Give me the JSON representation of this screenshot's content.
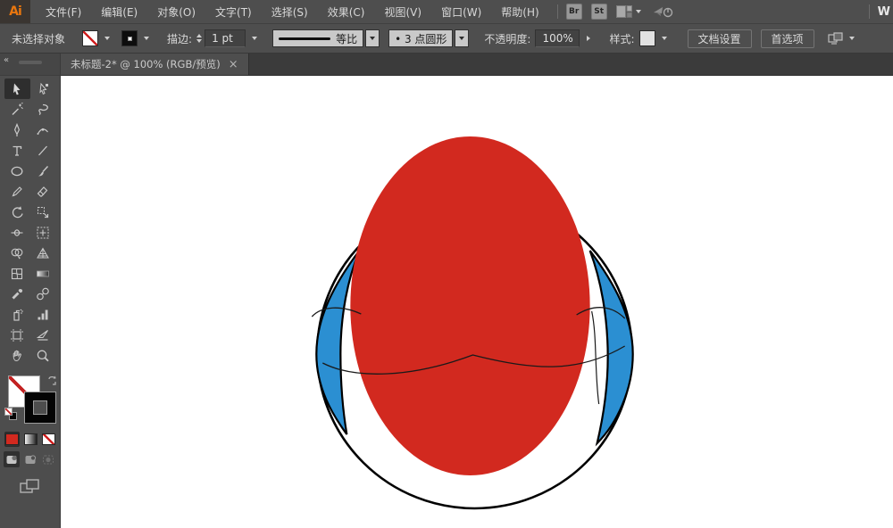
{
  "menu_bar": {
    "logo": "Ai",
    "items": [
      {
        "name": "file",
        "label": "文件(F)"
      },
      {
        "name": "edit",
        "label": "编辑(E)"
      },
      {
        "name": "object",
        "label": "对象(O)"
      },
      {
        "name": "type",
        "label": "文字(T)"
      },
      {
        "name": "select",
        "label": "选择(S)"
      },
      {
        "name": "effect",
        "label": "效果(C)"
      },
      {
        "name": "view",
        "label": "视图(V)"
      },
      {
        "name": "window",
        "label": "窗口(W)"
      },
      {
        "name": "help",
        "label": "帮助(H)"
      }
    ],
    "bridge_label": "Br",
    "stock_label": "St",
    "partial_text": "W"
  },
  "control_bar": {
    "selection_status": "未选择对象",
    "stroke_label": "描边:",
    "stroke_width_value": "1 pt",
    "width_profile_label": "等比",
    "brush_value": "• 3 点圆形",
    "opacity_label": "不透明度:",
    "opacity_value": "100%",
    "style_label": "样式:",
    "document_setup_label": "文档设置",
    "preferences_label": "首选项"
  },
  "document_tab": {
    "title": "未标题-2* @ 100% (RGB/预览)",
    "close_glyph": "×"
  },
  "toolbar": {
    "collapse_glyph": "«",
    "tools": [
      {
        "name": "selection-tool",
        "active": true
      },
      {
        "name": "direct-selection-tool"
      },
      {
        "name": "magic-wand-tool"
      },
      {
        "name": "lasso-tool"
      },
      {
        "name": "pen-tool"
      },
      {
        "name": "curvature-tool"
      },
      {
        "name": "type-tool"
      },
      {
        "name": "line-segment-tool"
      },
      {
        "name": "ellipse-tool"
      },
      {
        "name": "paintbrush-tool"
      },
      {
        "name": "pencil-tool"
      },
      {
        "name": "eraser-tool"
      },
      {
        "name": "rotate-tool"
      },
      {
        "name": "scale-tool"
      },
      {
        "name": "width-tool"
      },
      {
        "name": "free-transform-tool"
      },
      {
        "name": "shape-builder-tool"
      },
      {
        "name": "perspective-grid-tool"
      },
      {
        "name": "mesh-tool"
      },
      {
        "name": "gradient-tool"
      },
      {
        "name": "eyedropper-tool"
      },
      {
        "name": "blend-tool"
      },
      {
        "name": "symbol-sprayer-tool"
      },
      {
        "name": "column-graph-tool"
      },
      {
        "name": "artboard-tool"
      },
      {
        "name": "slice-tool"
      },
      {
        "name": "hand-tool"
      },
      {
        "name": "zoom-tool"
      }
    ]
  },
  "colors": {
    "ui_accent_red": "#d2291f",
    "fill_indicator": "none",
    "stroke_indicator": "#000000"
  },
  "artwork": {
    "face_color": "#d2291f",
    "side_color": "#2b8fd2",
    "outline_color": "#000000",
    "line_color": "#1a1a1a",
    "background": "#ffffff",
    "zoom_level": "100%"
  }
}
